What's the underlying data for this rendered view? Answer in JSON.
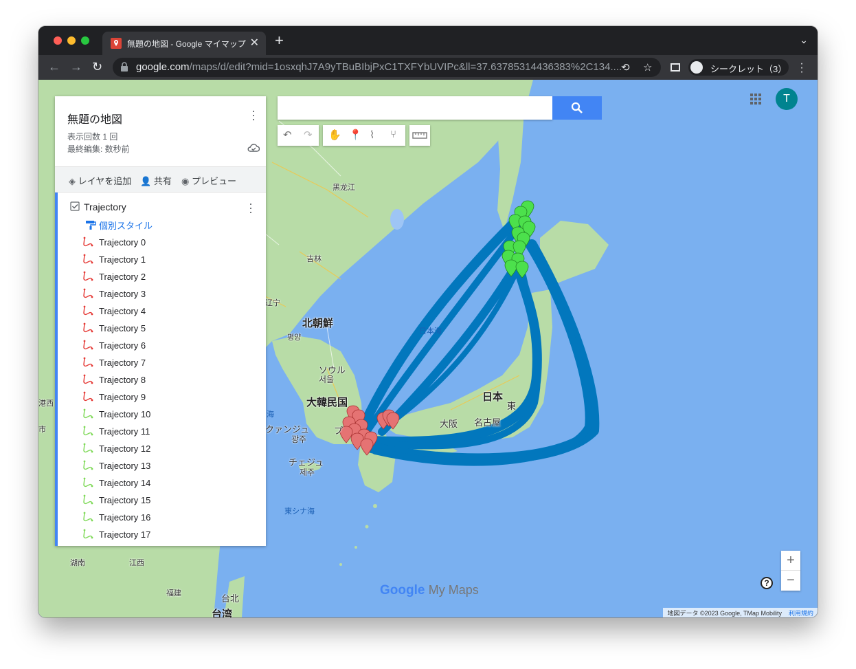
{
  "browser": {
    "tab_title": "無題の地図 - Google マイマップ",
    "url_host": "google.com",
    "url_rest": "/maps/d/edit?mid=1osxqhJ7A9yTBuBIbjPxC1TXFYbUVIPc&ll=37.63785314436383%2C134....",
    "incognito_label": "シークレット（3）",
    "colors": {
      "frame": "#202124",
      "toolbar": "#35363a"
    }
  },
  "panel": {
    "title": "無題の地図",
    "views": "表示回数 1 回",
    "last_edit": "最終編集: 数秒前",
    "actions": {
      "add_layer": "レイヤを追加",
      "share": "共有",
      "preview": "プレビュー"
    },
    "layer": {
      "title": "Trajectory",
      "style_link": "個別スタイル",
      "items": [
        {
          "label": "Trajectory 0",
          "color": "#e53935"
        },
        {
          "label": "Trajectory 1",
          "color": "#e53935"
        },
        {
          "label": "Trajectory 2",
          "color": "#e53935"
        },
        {
          "label": "Trajectory 3",
          "color": "#e53935"
        },
        {
          "label": "Trajectory 4",
          "color": "#e53935"
        },
        {
          "label": "Trajectory 5",
          "color": "#e53935"
        },
        {
          "label": "Trajectory 6",
          "color": "#e53935"
        },
        {
          "label": "Trajectory 7",
          "color": "#e53935"
        },
        {
          "label": "Trajectory 8",
          "color": "#e53935"
        },
        {
          "label": "Trajectory 9",
          "color": "#e53935"
        },
        {
          "label": "Trajectory 10",
          "color": "#7ed957"
        },
        {
          "label": "Trajectory 11",
          "color": "#7ed957"
        },
        {
          "label": "Trajectory 12",
          "color": "#7ed957"
        },
        {
          "label": "Trajectory 13",
          "color": "#7ed957"
        },
        {
          "label": "Trajectory 14",
          "color": "#7ed957"
        },
        {
          "label": "Trajectory 15",
          "color": "#7ed957"
        },
        {
          "label": "Trajectory 16",
          "color": "#7ed957"
        },
        {
          "label": "Trajectory 17",
          "color": "#7ed957"
        }
      ]
    }
  },
  "user": {
    "avatar_initial": "T",
    "avatar_color": "#00838f"
  },
  "map": {
    "labels": {
      "heilongjiang": "黑龙江",
      "jilin": "吉林",
      "liaoning": "辽宁",
      "north_korea": "北朝鮮",
      "pyongyang": "평양",
      "seoul_kana": "ソウル",
      "seoul_hangul": "서울",
      "south_korea": "大韓民国",
      "gwangju_kana": "クァンジュ",
      "gwangju_hangul": "광주",
      "jeju_kana": "チェジュ",
      "jeju_hangul": "제주",
      "busan_fragment": "プ",
      "sea_japan": "日本海",
      "east_china_sea": "東シナ海",
      "japan": "日本",
      "tokyo_fragment": "東",
      "osaka": "大阪",
      "nagoya": "名古屋",
      "hunan": "湖南",
      "jiangxi": "江西",
      "fujian": "福建",
      "taipei": "台北",
      "taiwan": "台湾",
      "left_sea_fragment": "海",
      "left_city_fragment_1": "港西",
      "left_city_fragment_2": "市"
    },
    "brand": {
      "google": "Google",
      "suffix": "My Maps"
    },
    "attribution": "地図データ ©2023 Google, TMap Mobility",
    "terms": "利用規約",
    "zoom_in": "+",
    "zoom_out": "−",
    "help": "?",
    "colors": {
      "sea": "#7ab0f0",
      "land": "#b8dca7",
      "trajectory": "#0277bd",
      "origin_marker": "#e57373",
      "destination_marker": "#4ce04c"
    }
  }
}
